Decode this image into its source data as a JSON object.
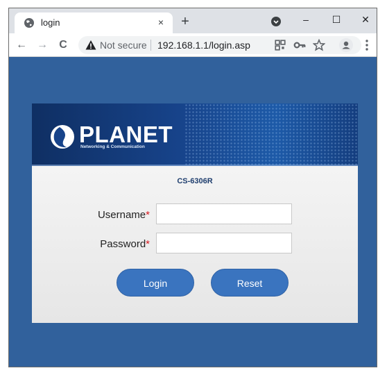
{
  "browser": {
    "tab": {
      "title": "login",
      "close": "×"
    },
    "new_tab": "+",
    "window_controls": {
      "minimize": "–",
      "maximize": "☐",
      "close": "✕"
    },
    "nav": {
      "back": "←",
      "forward": "→",
      "reload": "C"
    },
    "omnibox": {
      "security_text": "Not secure",
      "url": "192.168.1.1/login.asp"
    },
    "toolbar_icons": [
      "qr-code-icon",
      "key-icon",
      "star-icon",
      "profile-icon",
      "menu-icon"
    ]
  },
  "page": {
    "background_color": "#31619c",
    "brand": {
      "name": "PLANET",
      "tagline": "Networking & Communication"
    },
    "model": "CS-6306R",
    "form": {
      "username_label": "Username",
      "password_label": "Password",
      "required_mark": "*",
      "username_value": "",
      "password_value": "",
      "login_button": "Login",
      "reset_button": "Reset"
    }
  }
}
